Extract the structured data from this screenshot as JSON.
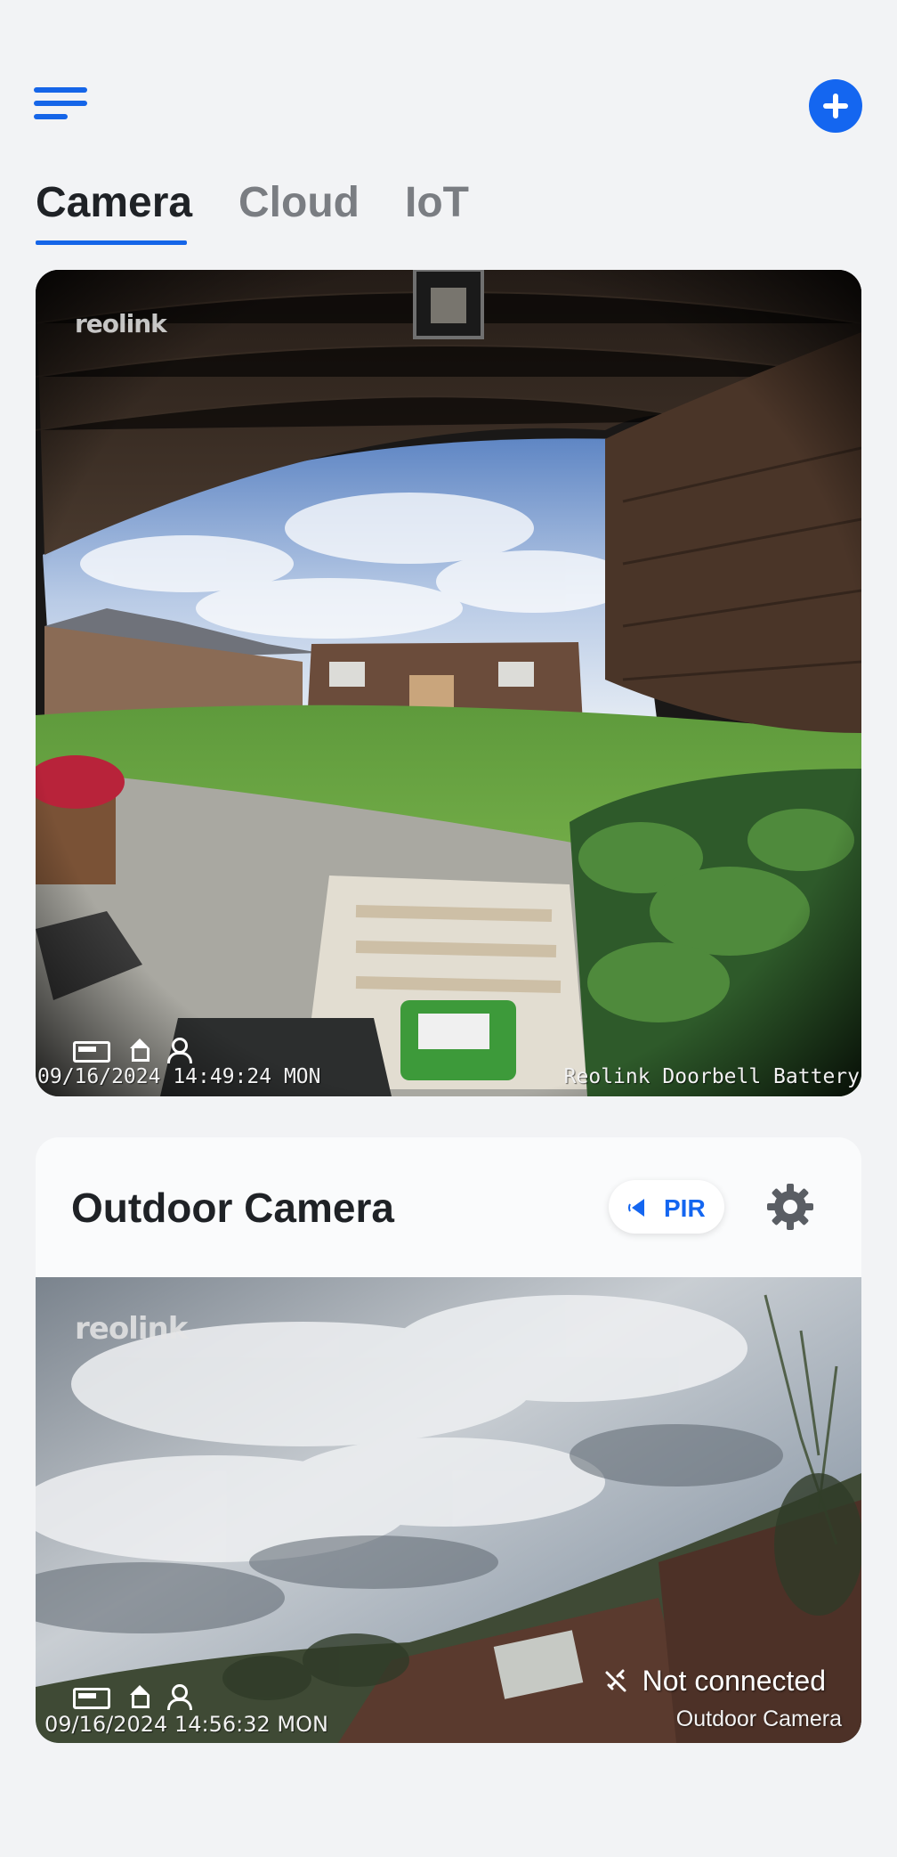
{
  "header": {
    "menu_icon": "menu-icon",
    "add_icon": "add-circle-icon",
    "accent_color": "#1565e8"
  },
  "tabs": [
    {
      "label": "Camera",
      "active": true
    },
    {
      "label": "Cloud",
      "active": false
    },
    {
      "label": "IoT",
      "active": false
    }
  ],
  "feeds": [
    {
      "watermark": "reolink",
      "timestamp": "09/16/2024 14:49:24 MON",
      "camera_label": "Reolink Doorbell Battery",
      "status_icons": [
        "battery-icon",
        "home-icon",
        "person-icon"
      ]
    }
  ],
  "outdoor_card": {
    "title": "Outdoor Camera",
    "pir_label": "PIR",
    "settings_icon": "gear-icon",
    "watermark": "reolink",
    "timestamp": "09/16/2024 14:56:32 MON",
    "status": "Not connected",
    "status_icon": "disconnected-icon",
    "camera_label": "Outdoor Camera",
    "status_icons": [
      "battery-icon",
      "home-icon",
      "person-icon"
    ]
  }
}
